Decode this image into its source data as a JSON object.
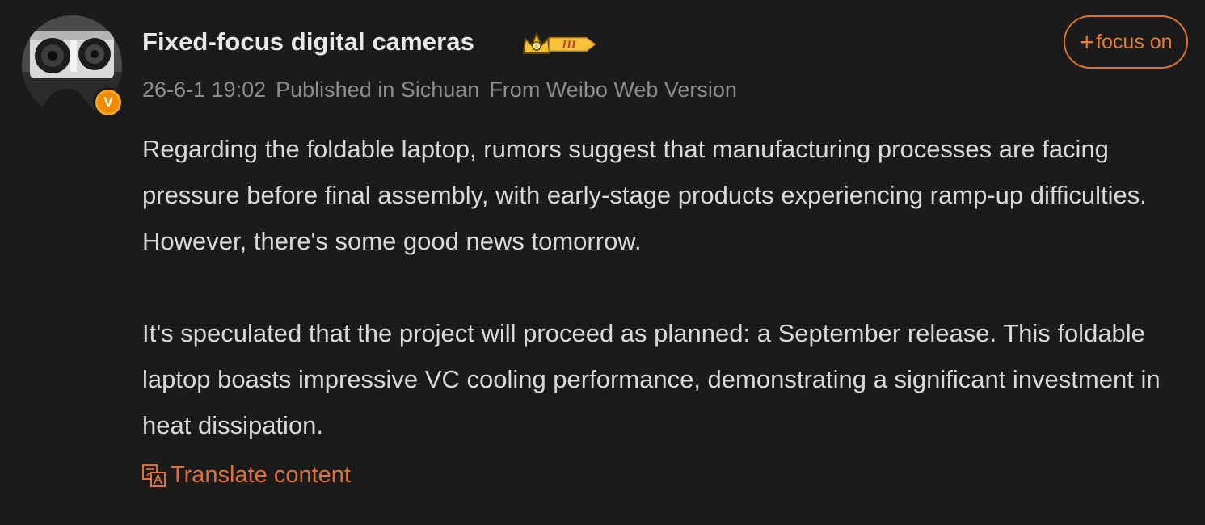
{
  "post": {
    "username": "Fixed-focus digital cameras",
    "rank_badge": "III",
    "verified_mark": "V",
    "timestamp": "26-6-1 19:02",
    "location": "Published in Sichuan",
    "source": "From Weibo Web Version",
    "follow_button": {
      "plus": "+",
      "label": "focus on"
    },
    "content": {
      "paragraph_1": "Regarding the foldable laptop, rumors suggest that manufacturing processes are facing pressure before final assembly, with early-stage products experiencing ramp-up difficulties. However, there's some good news tomorrow.",
      "paragraph_2": "It's speculated that the project will proceed as planned: a September release. This foldable laptop boasts impressive VC cooling performance, demonstrating a significant investment in heat dissipation."
    },
    "translate_label": "Translate content"
  },
  "icons": {
    "verified": "verified-badge-icon",
    "rank": "crown-rank-icon",
    "translate": "translate-icon"
  },
  "colors": {
    "background": "#1b1b1b",
    "accent_orange": "#e87d2e",
    "text_primary": "#e8e8e8",
    "text_body": "#d9d9d9",
    "text_meta": "#8d8d8d"
  }
}
